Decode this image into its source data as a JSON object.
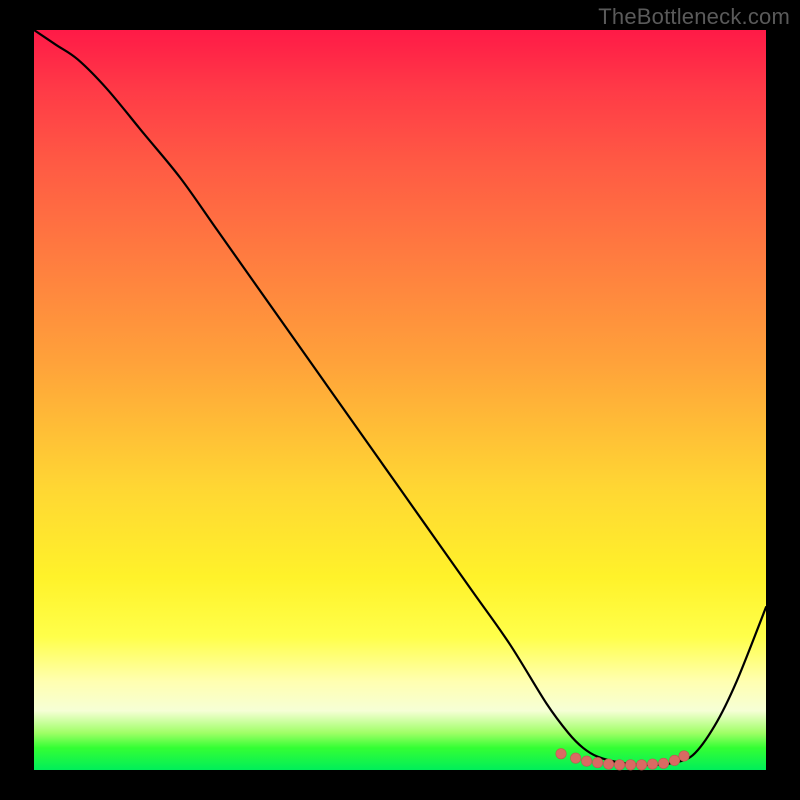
{
  "watermark": "TheBottleneck.com",
  "colors": {
    "background": "#000000",
    "watermark": "#5a5a5a",
    "line": "#000000",
    "marker": "#d96a63"
  },
  "chart_data": {
    "type": "line",
    "title": "",
    "xlabel": "",
    "ylabel": "",
    "xlim": [
      0,
      100
    ],
    "ylim": [
      0,
      100
    ],
    "grid": false,
    "legend": null,
    "series": [
      {
        "name": "bottleneck-curve",
        "x": [
          0,
          3,
          6,
          10,
          15,
          20,
          25,
          30,
          35,
          40,
          45,
          50,
          55,
          60,
          65,
          70,
          73,
          75,
          77,
          80,
          83,
          85,
          87,
          90,
          93,
          96,
          100
        ],
        "y": [
          100,
          98,
          96,
          92,
          86,
          80,
          73,
          66,
          59,
          52,
          45,
          38,
          31,
          24,
          17,
          9,
          5,
          3,
          1.8,
          1.0,
          0.7,
          0.7,
          0.9,
          2,
          6,
          12,
          22
        ]
      }
    ],
    "markers": {
      "name": "valley-points",
      "x": [
        72,
        74,
        75.5,
        77,
        78.5,
        80,
        81.5,
        83,
        84.5,
        86,
        87.5,
        88.8
      ],
      "y": [
        2.2,
        1.6,
        1.2,
        1.0,
        0.8,
        0.7,
        0.7,
        0.7,
        0.8,
        0.9,
        1.3,
        1.9
      ]
    }
  }
}
